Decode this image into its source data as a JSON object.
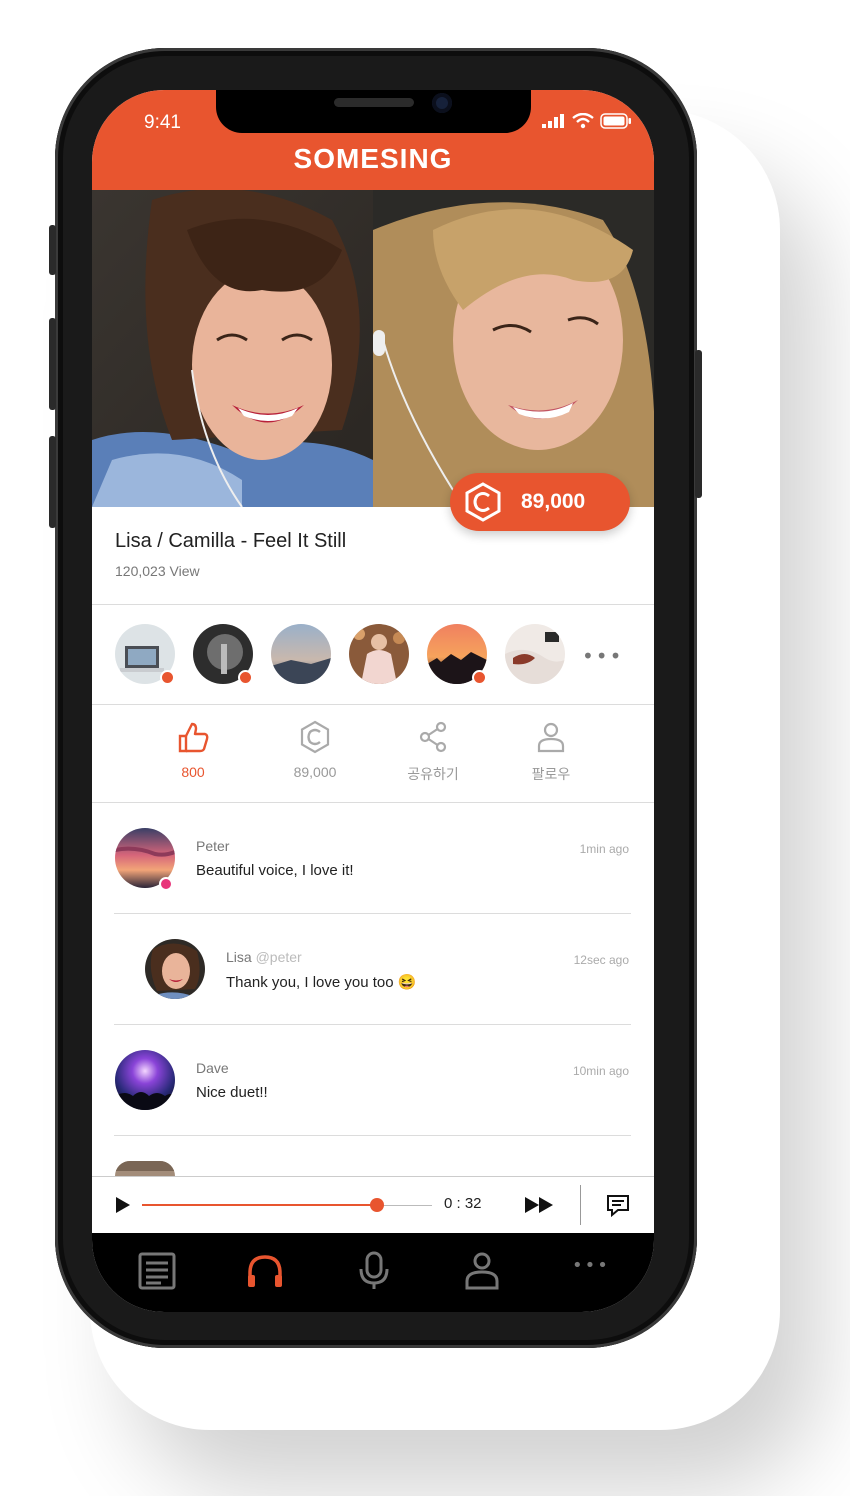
{
  "status_bar": {
    "time": "9:41"
  },
  "app": {
    "title": "SOMESING"
  },
  "video": {
    "coin_badge_value": "89,000"
  },
  "song": {
    "title": "Lisa / Camilla - Feel It Still",
    "views": "120,023 View"
  },
  "participants": {
    "more_label": "•••"
  },
  "actions": {
    "like_count": "800",
    "coin_count": "89,000",
    "share_label": "공유하기",
    "follow_label": "팔로우"
  },
  "comments": [
    {
      "name": "Peter",
      "mention": "",
      "text": "Beautiful voice, I love it!",
      "time": "1min ago"
    },
    {
      "name": "Lisa",
      "mention": "@peter",
      "text": "Thank you, I love you too 😆",
      "time": "12sec ago"
    },
    {
      "name": "Dave",
      "mention": "",
      "text": "Nice duet!!",
      "time": "10min ago"
    }
  ],
  "player": {
    "time": "0 : 32",
    "progress": 0.81
  },
  "tabbar": {
    "more_label": "•••"
  },
  "colors": {
    "accent": "#e8552f",
    "online_dot": "#e8552f",
    "pink_dot": "#e8357a"
  }
}
